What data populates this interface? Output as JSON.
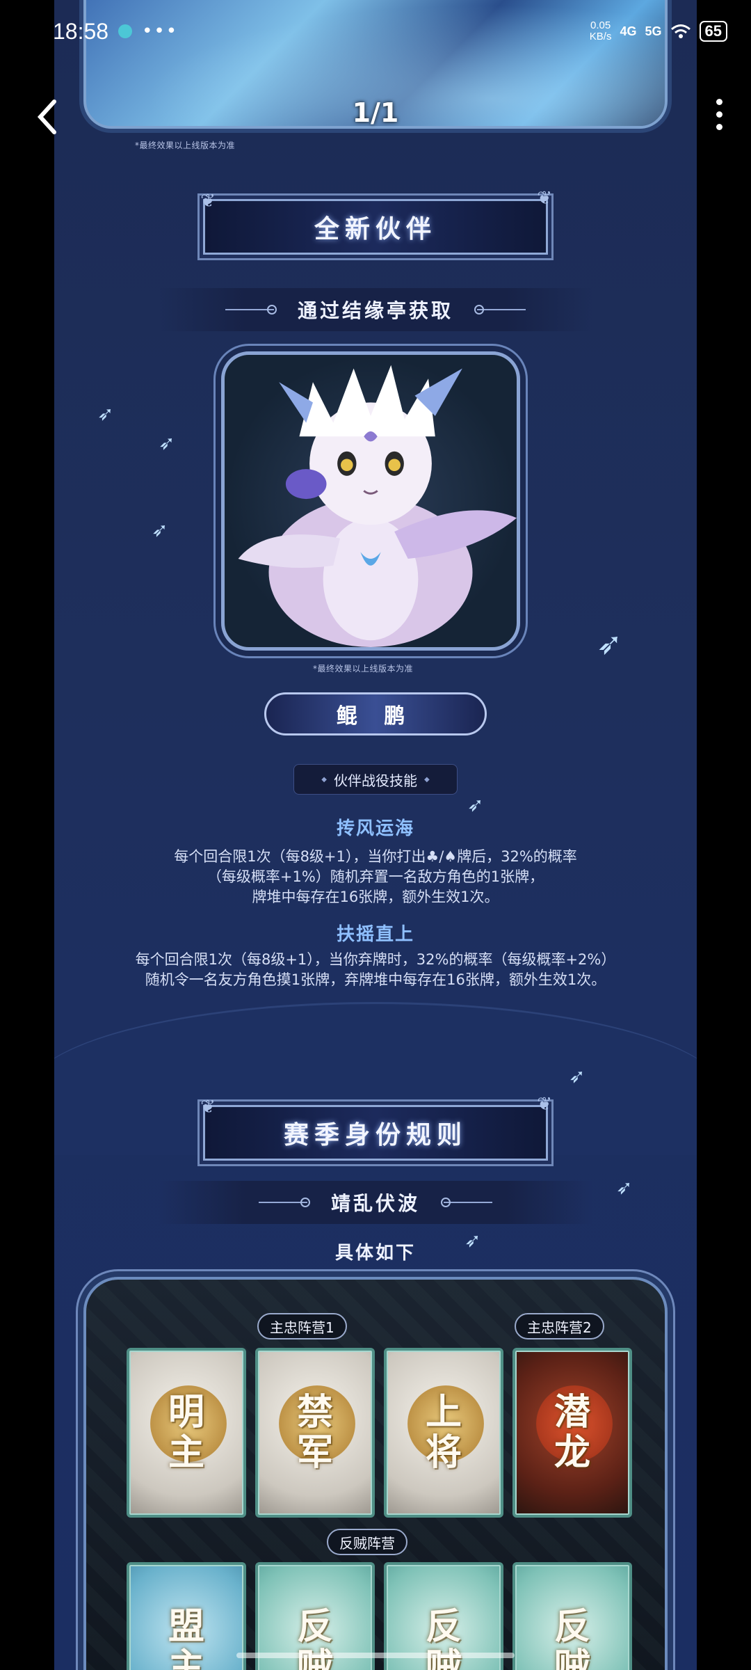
{
  "status_bar": {
    "time": "18:58",
    "more": "•••",
    "net_speed_value": "0.05",
    "net_speed_unit": "KB/s",
    "signal_1": "4G",
    "signal_2": "5G",
    "battery": "65"
  },
  "viewer": {
    "counter": "1/1"
  },
  "notes": {
    "final_effect": "*最终效果以上线版本为准"
  },
  "section_partner": {
    "title": "全新伙伴",
    "subtitle": "通过结缘亭获取",
    "partner_name": "鲲 鹏",
    "skill_tag": "伙伴战役技能",
    "skills": [
      {
        "name": "抟风运海",
        "lines": [
          "每个回合限1次（每8级+1），当你打出♣/♠牌后，32%的概率",
          "（每级概率+1%）随机弃置一名敌方角色的1张牌，",
          "牌堆中每存在16张牌，额外生效1次。"
        ]
      },
      {
        "name": "扶摇直上",
        "lines": [
          "每个回合限1次（每8级+1），当你弃牌时，32%的概率（每级概率+2%）",
          "随机令一名友方角色摸1张牌，弃牌堆中每存在16张牌，额外生效1次。"
        ]
      }
    ]
  },
  "section_identity": {
    "title": "赛季身份规则",
    "subtitle": "靖乱伏波",
    "intro": "具体如下",
    "groups": {
      "loyal_1": "主忠阵营1",
      "loyal_2": "主忠阵营2",
      "rebel": "反贼阵营"
    },
    "row1_cards": [
      {
        "l1": "明",
        "l2": "主"
      },
      {
        "l1": "禁",
        "l2": "军"
      },
      {
        "l1": "上",
        "l2": "将"
      },
      {
        "l1": "潜",
        "l2": "龙"
      }
    ],
    "row2_cards": [
      {
        "l1": "盟",
        "l2": "主"
      },
      {
        "l1": "反",
        "l2": "贼"
      },
      {
        "l1": "反",
        "l2": "贼"
      },
      {
        "l1": "反",
        "l2": "贼"
      }
    ]
  }
}
